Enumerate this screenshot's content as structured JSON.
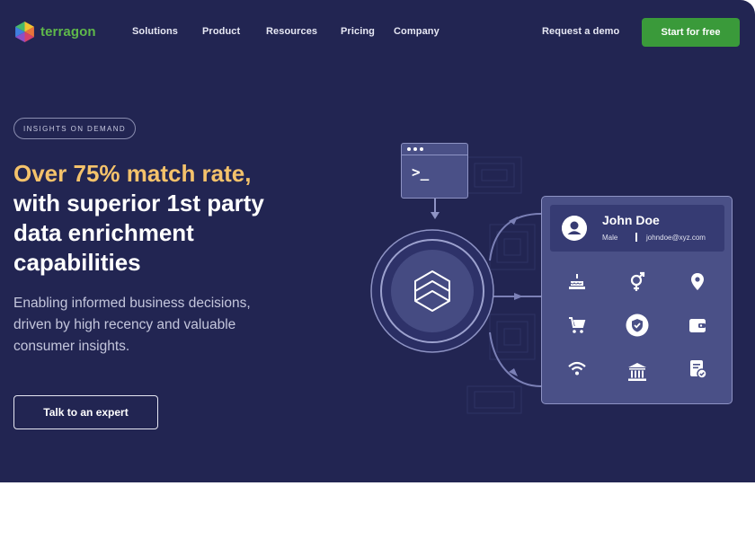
{
  "brand": {
    "name": "terragon",
    "colors": {
      "hero_bg": "#222552",
      "accent": "#f4c26b",
      "cta_green": "#3a9a3a",
      "card": "#4a5087"
    }
  },
  "nav": {
    "items": [
      "Solutions",
      "Product",
      "Resources",
      "Pricing",
      "Company"
    ],
    "request_demo": "Request a demo",
    "cta": "Start for free"
  },
  "hero": {
    "eyebrow": "INSIGHTS ON DEMAND",
    "headline_accent": "Over 75% match rate,",
    "headline_rest": "with superior 1st party data enrichment capabilities",
    "subtitle": "Enabling informed business decisions, driven by high recency and valuable consumer insights.",
    "button": "Talk to an expert"
  },
  "illustration": {
    "terminal_prompt": ">_",
    "profile": {
      "name": "John Doe",
      "gender": "Male",
      "email": "johndoe@xyz.com"
    },
    "attribute_icons": [
      "birthday-cake-icon",
      "gender-icon",
      "location-pin-icon",
      "shopping-cart-icon",
      "shield-check-icon",
      "wallet-icon",
      "wifi-icon",
      "bank-icon",
      "document-check-icon"
    ]
  }
}
